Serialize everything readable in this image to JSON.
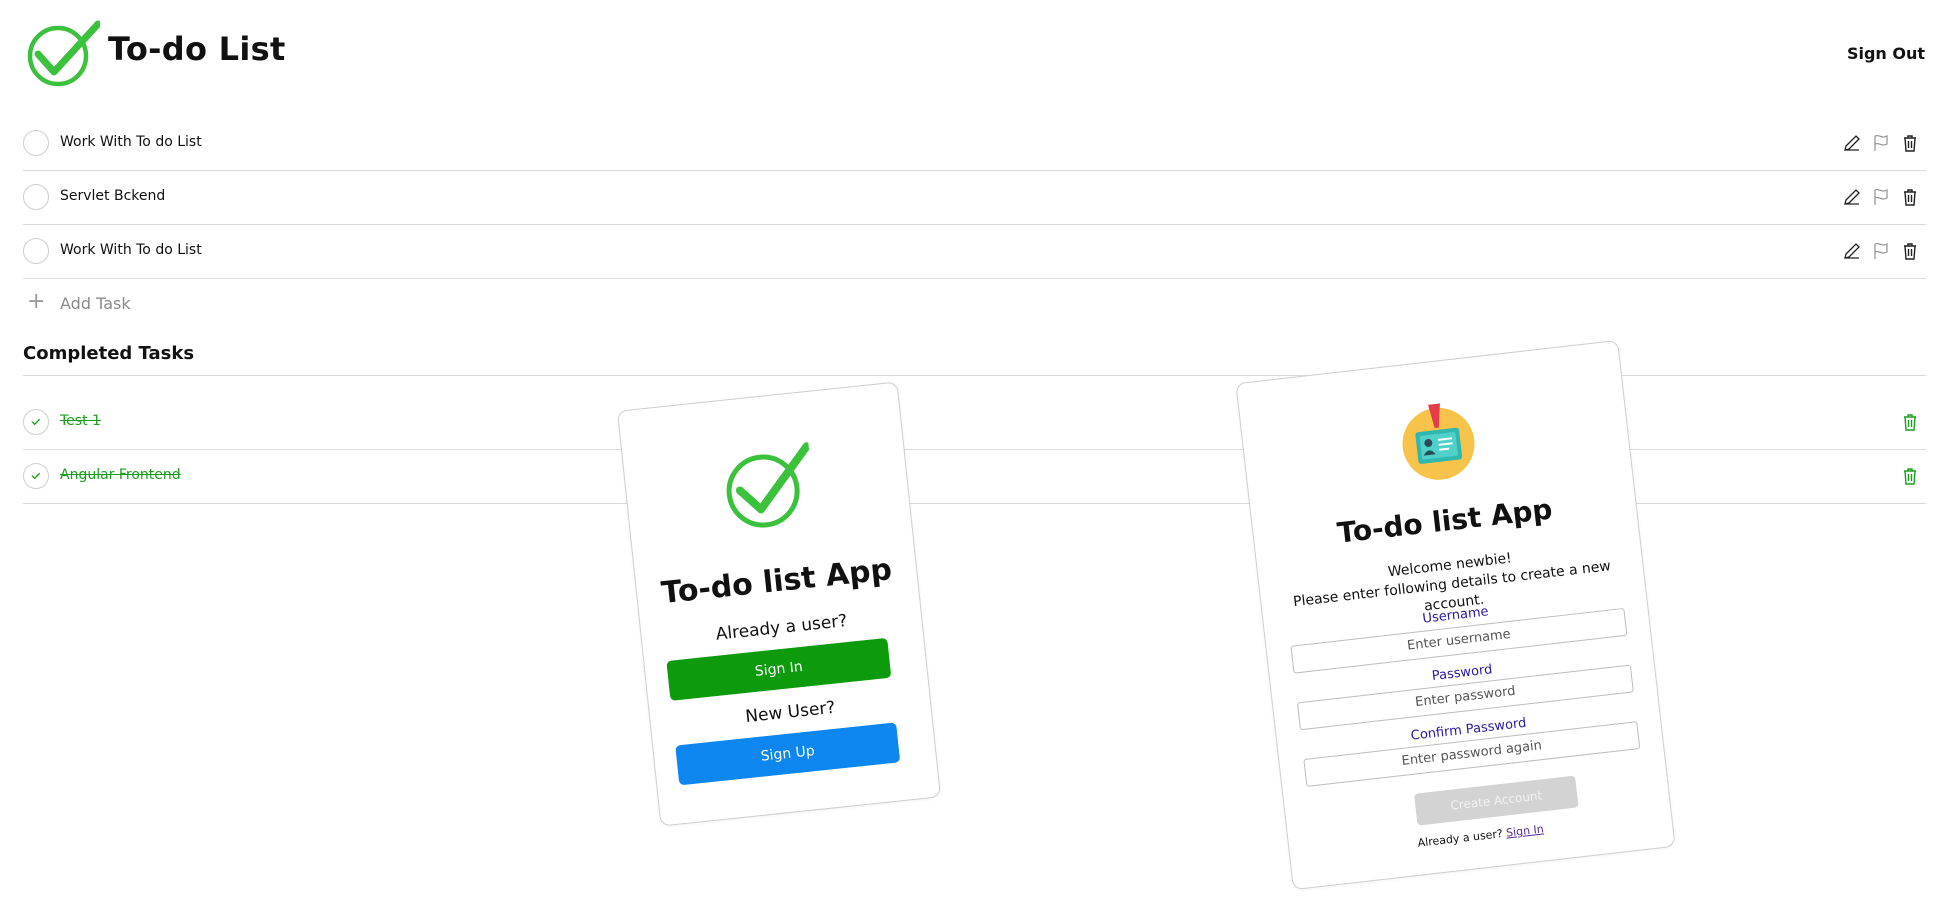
{
  "header": {
    "title": "To-do List",
    "sign_out": "Sign Out"
  },
  "tasks": [
    {
      "label": "Work With To do List"
    },
    {
      "label": "Servlet Bckend"
    },
    {
      "label": "Work With To do List"
    }
  ],
  "add_task": {
    "label": "Add Task"
  },
  "completed": {
    "title": "Completed Tasks",
    "items": [
      {
        "label": "Test 1"
      },
      {
        "label": "Angular Frontend"
      }
    ]
  },
  "signin_card": {
    "title": "To-do list App",
    "already_user": "Already a user?",
    "sign_in": "Sign In",
    "new_user": "New User?",
    "sign_up": "Sign Up"
  },
  "signup_card": {
    "title": "To-do list App",
    "welcome": "Welcome newbie!",
    "instructions": "Please enter following details to create a new account.",
    "username_label": "Username",
    "username_placeholder": "Enter username",
    "password_label": "Password",
    "password_placeholder": "Enter password",
    "confirm_label": "Confirm Password",
    "confirm_placeholder": "Enter password again",
    "create_button": "Create Account",
    "footer_text": "Already a user?",
    "footer_link": "Sign In"
  },
  "colors": {
    "check_green": "#3cc13c",
    "completed_green": "#1b9e1b",
    "signin_button": "#0d9a0d",
    "signup_button": "#0d86f0",
    "disabled_button": "#d3d3d3",
    "label_purple": "#2a1a9e"
  },
  "icons": [
    "check-logo-icon",
    "edit-icon",
    "flag-icon",
    "trash-icon",
    "plus-icon",
    "check-icon",
    "id-badge-icon"
  ]
}
